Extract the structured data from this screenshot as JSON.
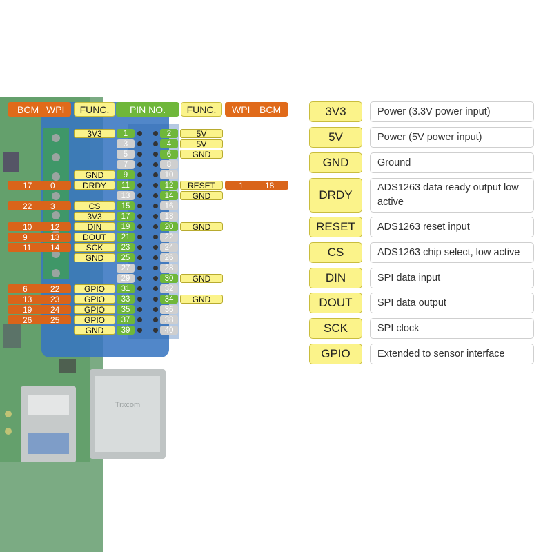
{
  "header": {
    "left_bcm": "BCM",
    "left_wpi": "WPI",
    "left_func": "FUNC.",
    "pin_no": "PIN NO.",
    "right_func": "FUNC.",
    "right_wpi": "WPI",
    "right_bcm": "BCM"
  },
  "pins": [
    {
      "pin": "1",
      "left_func": "3V3",
      "left_bcm": "",
      "left_wpi": "",
      "pin_r": "2",
      "right_func": "5V",
      "right_wpi": "",
      "right_bcm": ""
    },
    {
      "pin": "3",
      "left_func": "",
      "left_bcm": "",
      "left_wpi": "",
      "pin_r": "4",
      "right_func": "5V",
      "right_wpi": "",
      "right_bcm": ""
    },
    {
      "pin": "5",
      "left_func": "",
      "left_bcm": "",
      "left_wpi": "",
      "pin_r": "6",
      "right_func": "GND",
      "right_wpi": "",
      "right_bcm": ""
    },
    {
      "pin": "7",
      "left_func": "",
      "left_bcm": "",
      "left_wpi": "",
      "pin_r": "8",
      "right_func": "",
      "right_wpi": "",
      "right_bcm": ""
    },
    {
      "pin": "9",
      "left_func": "GND",
      "left_bcm": "",
      "left_wpi": "",
      "pin_r": "10",
      "right_func": "",
      "right_wpi": "",
      "right_bcm": ""
    },
    {
      "pin": "11",
      "left_func": "DRDY",
      "left_bcm": "17",
      "left_wpi": "0",
      "pin_r": "12",
      "right_func": "RESET",
      "right_wpi": "1",
      "right_bcm": "18"
    },
    {
      "pin": "13",
      "left_func": "",
      "left_bcm": "",
      "left_wpi": "",
      "pin_r": "14",
      "right_func": "GND",
      "right_wpi": "",
      "right_bcm": ""
    },
    {
      "pin": "15",
      "left_func": "CS",
      "left_bcm": "22",
      "left_wpi": "3",
      "pin_r": "16",
      "right_func": "",
      "right_wpi": "",
      "right_bcm": ""
    },
    {
      "pin": "17",
      "left_func": "3V3",
      "left_bcm": "",
      "left_wpi": "",
      "pin_r": "18",
      "right_func": "",
      "right_wpi": "",
      "right_bcm": ""
    },
    {
      "pin": "19",
      "left_func": "DIN",
      "left_bcm": "10",
      "left_wpi": "12",
      "pin_r": "20",
      "right_func": "GND",
      "right_wpi": "",
      "right_bcm": ""
    },
    {
      "pin": "21",
      "left_func": "DOUT",
      "left_bcm": "9",
      "left_wpi": "13",
      "pin_r": "22",
      "right_func": "",
      "right_wpi": "",
      "right_bcm": ""
    },
    {
      "pin": "23",
      "left_func": "SCK",
      "left_bcm": "11",
      "left_wpi": "14",
      "pin_r": "24",
      "right_func": "",
      "right_wpi": "",
      "right_bcm": ""
    },
    {
      "pin": "25",
      "left_func": "GND",
      "left_bcm": "",
      "left_wpi": "",
      "pin_r": "26",
      "right_func": "",
      "right_wpi": "",
      "right_bcm": ""
    },
    {
      "pin": "27",
      "left_func": "",
      "left_bcm": "",
      "left_wpi": "",
      "pin_r": "28",
      "right_func": "",
      "right_wpi": "",
      "right_bcm": ""
    },
    {
      "pin": "29",
      "left_func": "",
      "left_bcm": "",
      "left_wpi": "",
      "pin_r": "30",
      "right_func": "GND",
      "right_wpi": "",
      "right_bcm": ""
    },
    {
      "pin": "31",
      "left_func": "GPIO",
      "left_bcm": "6",
      "left_wpi": "22",
      "pin_r": "32",
      "right_func": "",
      "right_wpi": "",
      "right_bcm": ""
    },
    {
      "pin": "33",
      "left_func": "GPIO",
      "left_bcm": "13",
      "left_wpi": "23",
      "pin_r": "34",
      "right_func": "GND",
      "right_wpi": "",
      "right_bcm": ""
    },
    {
      "pin": "35",
      "left_func": "GPIO",
      "left_bcm": "19",
      "left_wpi": "24",
      "pin_r": "36",
      "right_func": "",
      "right_wpi": "",
      "right_bcm": ""
    },
    {
      "pin": "37",
      "left_func": "GPIO",
      "left_bcm": "26",
      "left_wpi": "25",
      "pin_r": "38",
      "right_func": "",
      "right_wpi": "",
      "right_bcm": ""
    },
    {
      "pin": "39",
      "left_func": "GND",
      "left_bcm": "",
      "left_wpi": "",
      "pin_r": "40",
      "right_func": "",
      "right_wpi": "",
      "right_bcm": ""
    }
  ],
  "legend": [
    {
      "name": "3V3",
      "desc": "Power (3.3V power input)"
    },
    {
      "name": "5V",
      "desc": "Power (5V power input)"
    },
    {
      "name": "GND",
      "desc": "Ground"
    },
    {
      "name": "DRDY",
      "desc": "ADS1263 data ready output low active"
    },
    {
      "name": "RESET",
      "desc": "ADS1263 reset input"
    },
    {
      "name": "CS",
      "desc": "ADS1263 chip select, low active"
    },
    {
      "name": "DIN",
      "desc": "SPI data input"
    },
    {
      "name": "DOUT",
      "desc": "SPI data output"
    },
    {
      "name": "SCK",
      "desc": "SPI clock"
    },
    {
      "name": "GPIO",
      "desc": "Extended to sensor interface"
    }
  ],
  "colors": {
    "orange": "#e06a1a",
    "yellow": "#fbf38a",
    "green": "#6fb73a",
    "gray": "#cfcfcf"
  }
}
